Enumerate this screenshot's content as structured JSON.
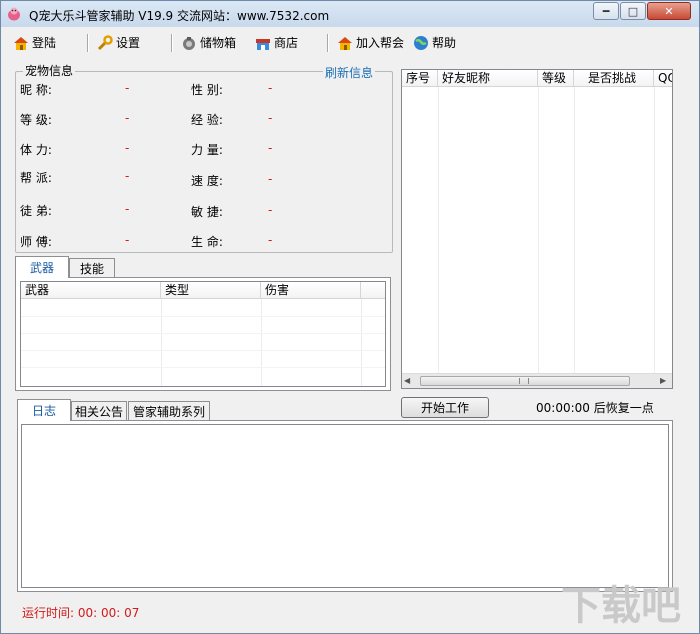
{
  "window": {
    "title": "Q宠大乐斗管家辅助 V19.9 交流网站：www.7532.com"
  },
  "toolbar": {
    "items": [
      {
        "label": "登陆",
        "icon": "home-icon"
      },
      {
        "label": "设置",
        "icon": "wrench-icon"
      },
      {
        "label": "储物箱",
        "icon": "storage-box-icon"
      },
      {
        "label": "商店",
        "icon": "shop-icon"
      },
      {
        "label": "加入帮会",
        "icon": "home-icon"
      },
      {
        "label": "帮助",
        "icon": "help-globe-icon"
      }
    ]
  },
  "pet_info": {
    "title": "宠物信息",
    "refresh_label": "刷新信息",
    "left_fields": [
      {
        "label": "昵  称:",
        "value": "-"
      },
      {
        "label": "等  级:",
        "value": "-"
      },
      {
        "label": "体  力:",
        "value": "-"
      },
      {
        "label": "帮  派:",
        "value": "-"
      },
      {
        "label": "徒  弟:",
        "value": "-"
      },
      {
        "label": "师  傅:",
        "value": "-"
      }
    ],
    "right_fields": [
      {
        "label": "性  别:",
        "value": "-"
      },
      {
        "label": "经  验:",
        "value": "-"
      },
      {
        "label": "力  量:",
        "value": "-"
      },
      {
        "label": "速  度:",
        "value": "-"
      },
      {
        "label": "敏  捷:",
        "value": "-"
      },
      {
        "label": "生  命:",
        "value": "-"
      }
    ]
  },
  "weapon_tabs": {
    "tabs": [
      "武器",
      "技能"
    ],
    "columns": [
      "武器",
      "类型",
      "伤害"
    ]
  },
  "friend_list": {
    "columns": [
      "序号",
      "好友昵称",
      "等级",
      "是否挑战",
      "QQ"
    ]
  },
  "log_tabs": {
    "tabs": [
      "日志",
      "相关公告",
      "管家辅助系列"
    ]
  },
  "controls": {
    "start_button": "开始工作",
    "recover_text": "00:00:00 后恢复一点"
  },
  "status": {
    "runtime": "运行时间: 00: 00: 07"
  },
  "watermark": {
    "text": "下载吧"
  },
  "colors": {
    "value_red": "#d11a1a",
    "link_blue": "#1a6fb5"
  }
}
